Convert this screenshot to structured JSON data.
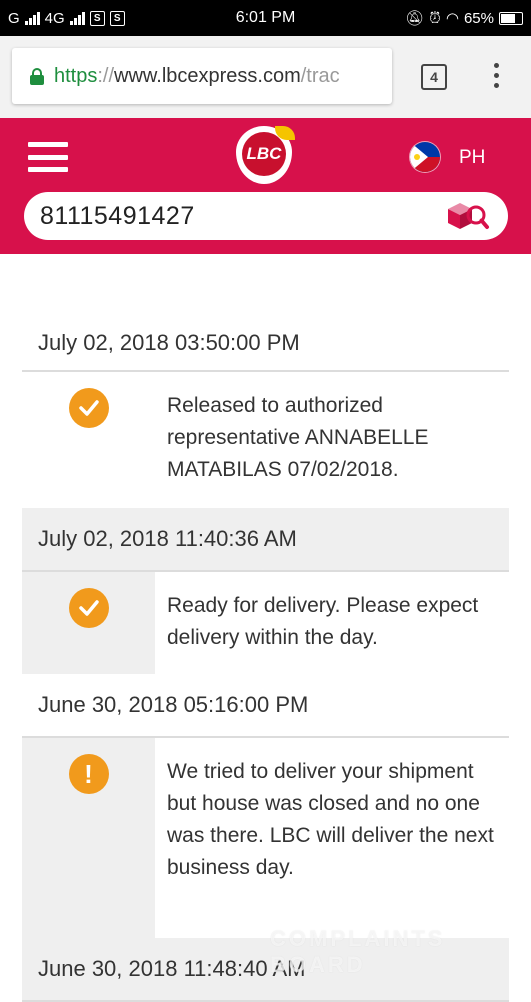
{
  "status_bar": {
    "carrier_left": "G",
    "network": "4G",
    "sim_badges": [
      "S",
      "S"
    ],
    "time": "6:01 PM",
    "battery": "65%"
  },
  "browser": {
    "url_scheme": "https",
    "url_sep": "://",
    "url_host": "www.lbcexpress.com",
    "url_path": "/trac",
    "tab_count": "4"
  },
  "header": {
    "logo_text": "LBC",
    "country": "PH"
  },
  "search": {
    "tracking_number": "81115491427"
  },
  "colors": {
    "brand": "#d7114b",
    "status": "#f19a1c",
    "secure": "#1e8e3e"
  },
  "events": [
    {
      "date": "July 02, 2018 03:50:00 PM",
      "icon": "check-circle-icon",
      "description": "Released to authorized representative ANNABELLE MATABILAS 07/02/2018."
    },
    {
      "date": "July 02, 2018 11:40:36 AM",
      "icon": "check-circle-icon",
      "description": "Ready for delivery. Please expect delivery within the day."
    },
    {
      "date": "June 30, 2018 05:16:00 PM",
      "icon": "alert-circle-icon",
      "description": "We tried to deliver your shipment but house was closed and no one was there. LBC will deliver the next business day."
    },
    {
      "date": "June 30, 2018 11:48:40 AM"
    }
  ],
  "watermark": "COMPLAINTS BOARD"
}
